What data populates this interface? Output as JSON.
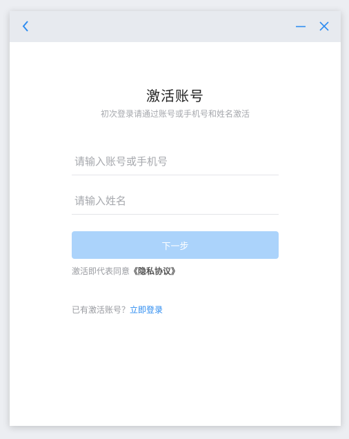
{
  "window": {
    "title": "激活账号",
    "subtitle": "初次登录请通过账号或手机号和姓名激活"
  },
  "titlebar": {
    "icons": [
      "back-arrow",
      "minimize",
      "close"
    ]
  },
  "form": {
    "account_placeholder": "请输入账号或手机号",
    "account_value": "",
    "name_placeholder": "请输入姓名",
    "name_value": "",
    "next_label": "下一步"
  },
  "agreement": {
    "prefix": "激活即代表同意",
    "policy_label": "《隐私协议》"
  },
  "login": {
    "prompt": "已有激活账号？",
    "link_label": "立即登录"
  },
  "colors": {
    "accent": "#2d8cf0",
    "button_disabled": "#abd3fb",
    "titlebar_bg": "#e7eaef"
  }
}
